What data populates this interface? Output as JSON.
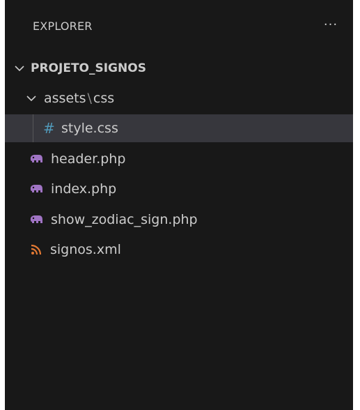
{
  "explorer": {
    "title": "EXPLORER",
    "more_glyph": "···",
    "root_folder": "PROJETO_SIGNOS",
    "subfolder": {
      "parent": "assets",
      "separator": "\\",
      "child": "css"
    },
    "files": {
      "style": "style.css",
      "header": "header.php",
      "index": "index.php",
      "show": "show_zodiac_sign.php",
      "xml": "signos.xml"
    },
    "icons": {
      "css": "hash-icon",
      "php": "php-elephant-icon",
      "xml": "rss-icon"
    },
    "colors": {
      "background": "#181818",
      "selected_row": "#37373d",
      "text": "#cccccc",
      "css_icon": "#519aba",
      "php_icon": "#a074c4",
      "rss_icon": "#e37933"
    }
  }
}
